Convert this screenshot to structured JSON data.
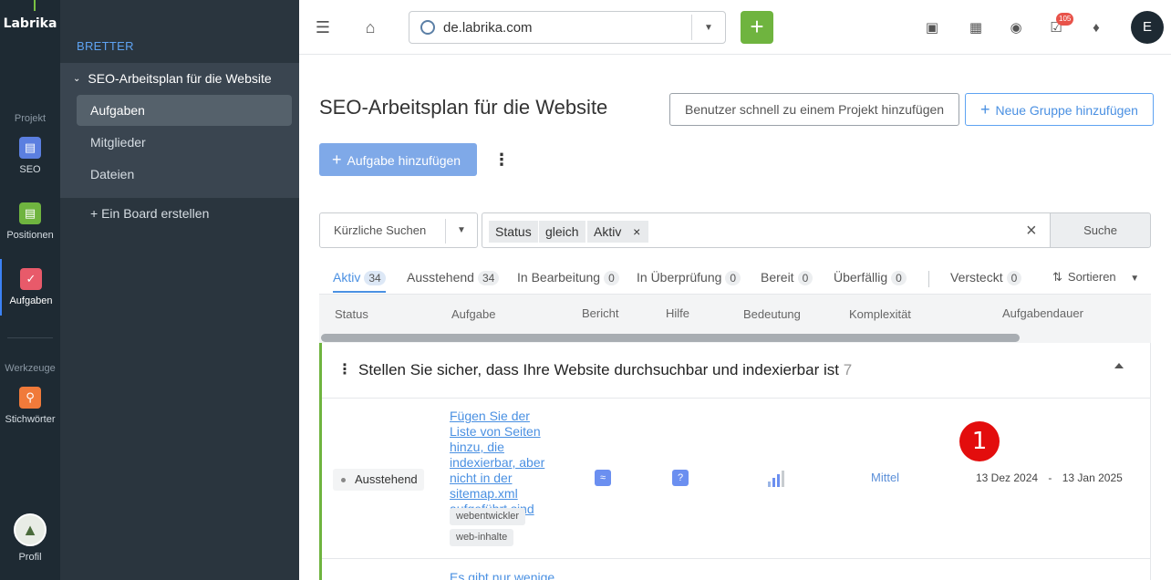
{
  "rail": {
    "logo": "Labrika",
    "group_project": "Projekt",
    "items": [
      {
        "label": "SEO",
        "icon": "clipboard-icon",
        "color": "#5b7fe0"
      },
      {
        "label": "Positionen",
        "icon": "chart-icon",
        "color": "#6fb43f"
      },
      {
        "label": "Aufgaben",
        "icon": "check-icon",
        "color": "#e85a6a"
      }
    ],
    "group_tools": "Werkzeuge",
    "tools": [
      {
        "label": "Stichwörter",
        "icon": "key-icon",
        "color": "#f07a3a"
      }
    ],
    "profile": "Profil"
  },
  "sidebar": {
    "heading": "BRETTER",
    "project": "SEO-Arbeitsplan für die Website",
    "links": [
      "Aufgaben",
      "Mitglieder",
      "Dateien"
    ],
    "add_board": "+ Ein Board erstellen"
  },
  "topbar": {
    "url": "de.labrika.com",
    "notif_count": "105",
    "user_initial": "E"
  },
  "main": {
    "title": "SEO-Arbeitsplan für die Website",
    "btn_add_user": "Benutzer schnell zu einem Projekt hinzufügen",
    "btn_add_group": "Neue Gruppe hinzufügen",
    "btn_add_task": "Aufgabe hinzufügen",
    "recent_searches": "Kürzliche Suchen",
    "filter": {
      "field": "Status",
      "op": "gleich",
      "value": "Aktiv"
    },
    "search_btn": "Suche",
    "tabs": [
      {
        "label": "Aktiv",
        "count": "34"
      },
      {
        "label": "Ausstehend",
        "count": "34"
      },
      {
        "label": "In Bearbeitung",
        "count": "0"
      },
      {
        "label": "In Überprüfung",
        "count": "0"
      },
      {
        "label": "Bereit",
        "count": "0"
      },
      {
        "label": "Überfällig",
        "count": "0"
      },
      {
        "label": "Versteckt",
        "count": "0"
      }
    ],
    "sort_label": "Sortieren",
    "columns": [
      "Status",
      "Aufgabe",
      "Bericht",
      "Hilfe",
      "Bedeutung",
      "Komplexität",
      "Aufgabendauer"
    ],
    "group": {
      "title": "Stellen Sie sicher, dass Ihre Website durchsuchbar und indexierbar ist",
      "count": "7"
    },
    "row": {
      "status": "Ausstehend",
      "task": "Fügen Sie der Liste von Seiten hinzu, die indexierbar, aber nicht in der sitemap.xml aufgeführt sind",
      "tags": [
        "webentwickler",
        "web-inhalte"
      ],
      "complexity": "Mittel",
      "date_from": "13 Dez 2024",
      "date_sep": "-",
      "date_to": "13 Jan 2025",
      "importance_level": 4
    },
    "next_row_task": "Es gibt nur wenige",
    "marker": "1"
  }
}
